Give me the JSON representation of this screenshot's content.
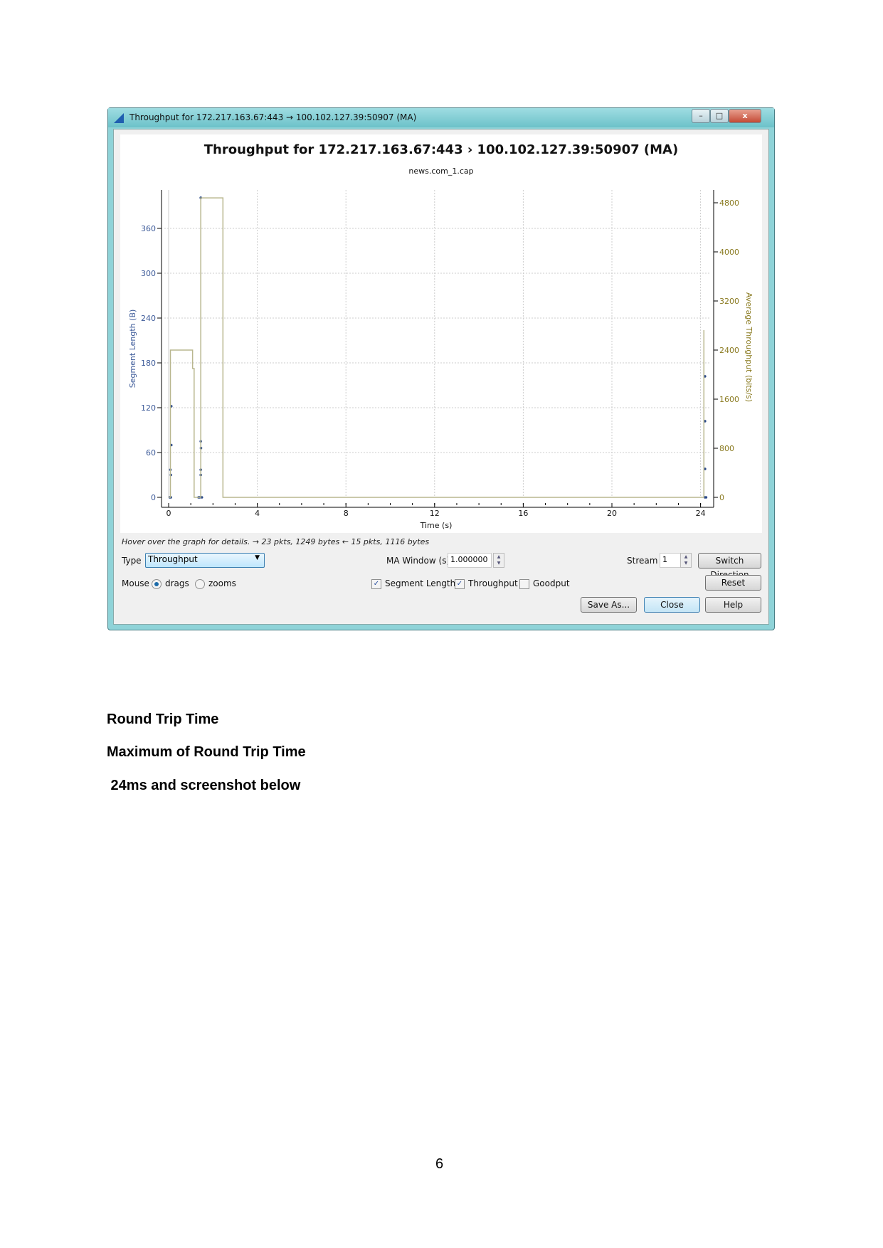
{
  "window": {
    "title": "Throughput for 172.217.163.67:443 → 100.102.127.39:50907 (MA)",
    "controls": {
      "minimize": "–",
      "maximize": "□",
      "close": "x"
    }
  },
  "hover_text": "Hover over the graph for details. → 23 pkts, 1249 bytes ← 15 pkts, 1116 bytes",
  "controls": {
    "type_label": "Type",
    "type_value": "Throughput",
    "ma_window_label": "MA Window (s)",
    "ma_window_value": "1.000000",
    "stream_label": "Stream",
    "stream_value": "1",
    "switch_direction": "Switch Direction",
    "mouse_label": "Mouse",
    "mouse_drags": "drags",
    "mouse_zooms": "zooms",
    "mouse_selected": "drags",
    "segment_length": {
      "label": "Segment Length",
      "checked": true
    },
    "throughput": {
      "label": "Throughput",
      "checked": true
    },
    "goodput": {
      "label": "Goodput",
      "checked": false
    },
    "reset": "Reset",
    "save_as": "Save As...",
    "close": "Close",
    "help": "Help"
  },
  "chart_data": {
    "type": "scatter+line",
    "title": "Throughput for 172.217.163.67:443  › 100.102.127.39:50907 (MA)",
    "subtitle": "news.com_1.cap",
    "xlabel": "Time (s)",
    "ylabel_left": "Segment Length (B)",
    "ylabel_right": "Average Throughput (bits/s)",
    "xlim": [
      -0.1,
      24.6
    ],
    "ylim_left": [
      0,
      410
    ],
    "ylim_right": [
      0,
      4950
    ],
    "x_ticks": [
      "0",
      "4",
      "8",
      "12",
      "16",
      "20",
      "24"
    ],
    "y_left_ticks": [
      "0",
      "60",
      "120",
      "180",
      "240",
      "300",
      "360"
    ],
    "y_right_ticks": [
      "0",
      "800",
      "1600",
      "2400",
      "3200",
      "4000",
      "4800"
    ],
    "grid": true,
    "colors": {
      "segment": "#2b4a8a",
      "throughput": "#b9b78f",
      "left_axis": "#3b5998",
      "right_axis": "#8a7a20"
    },
    "series": [
      {
        "name": "Segment Length",
        "axis": "left",
        "points": [
          [
            0.05,
            0
          ],
          [
            0.1,
            0
          ],
          [
            0.08,
            37
          ],
          [
            0.1,
            30
          ],
          [
            0.12,
            70
          ],
          [
            0.12,
            122
          ],
          [
            1.35,
            0
          ],
          [
            1.4,
            0
          ],
          [
            1.5,
            0
          ],
          [
            1.45,
            37
          ],
          [
            1.45,
            30
          ],
          [
            1.46,
            66
          ],
          [
            1.45,
            75
          ],
          [
            1.45,
            401
          ],
          [
            24.2,
            0
          ],
          [
            24.25,
            0
          ],
          [
            24.2,
            38
          ],
          [
            24.2,
            102
          ],
          [
            24.2,
            162
          ]
        ]
      },
      {
        "name": "Throughput",
        "axis": "right",
        "steps": [
          [
            0,
            0
          ],
          [
            0.08,
            0
          ],
          [
            0.08,
            2400
          ],
          [
            1.08,
            2400
          ],
          [
            1.08,
            2100
          ],
          [
            1.15,
            2100
          ],
          [
            1.15,
            0
          ],
          [
            1.45,
            0
          ],
          [
            1.45,
            4880
          ],
          [
            2.45,
            4880
          ],
          [
            2.45,
            0
          ],
          [
            24.15,
            0
          ],
          [
            24.15,
            2725
          ]
        ]
      }
    ]
  },
  "document": {
    "heading1": "Round Trip Time",
    "heading2": "Maximum of Round Trip Time",
    "text": " 24ms and screenshot below",
    "page_number": "6"
  }
}
